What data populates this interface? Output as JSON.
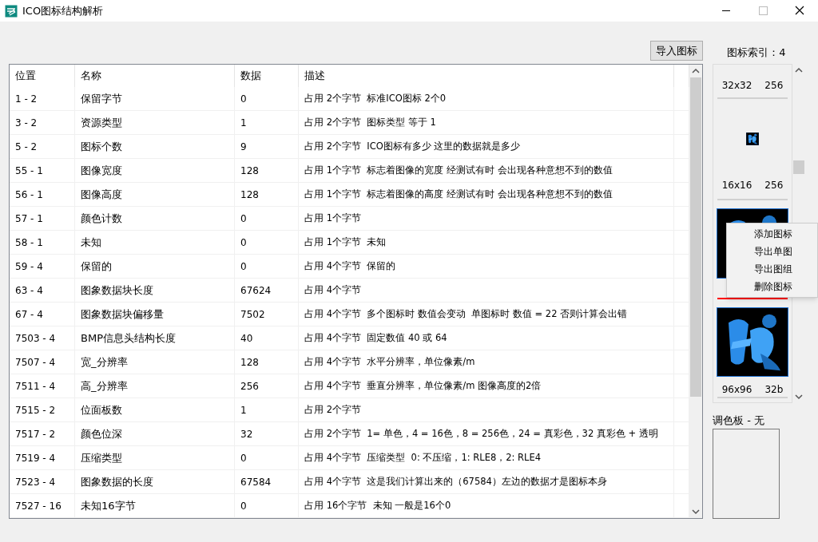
{
  "window": {
    "title": "ICO图标结构解析"
  },
  "import_button": "导入图标",
  "table": {
    "columns": [
      "位置",
      "名称",
      "数据",
      "描述"
    ],
    "rows": [
      {
        "position": "1 - 2",
        "name": "保留字节",
        "data": "0",
        "description": "占用 2个字节  标准ICO图标 2个0"
      },
      {
        "position": "3 - 2",
        "name": "资源类型",
        "data": "1",
        "description": "占用 2个字节  图标类型 等于 1"
      },
      {
        "position": "5 - 2",
        "name": "图标个数",
        "data": "9",
        "description": "占用 2个字节  ICO图标有多少 这里的数据就是多少"
      },
      {
        "position": "55 - 1",
        "name": "图像宽度",
        "data": "128",
        "description": "占用 1个字节  标志着图像的宽度 经测试有时 会出现各种意想不到的数值"
      },
      {
        "position": "56 - 1",
        "name": "图像高度",
        "data": "128",
        "description": "占用 1个字节  标志着图像的高度 经测试有时 会出现各种意想不到的数值"
      },
      {
        "position": "57 - 1",
        "name": "颜色计数",
        "data": "0",
        "description": "占用 1个字节"
      },
      {
        "position": "58 - 1",
        "name": "未知",
        "data": "0",
        "description": "占用 1个字节  未知"
      },
      {
        "position": "59 - 4",
        "name": "保留的",
        "data": "0",
        "description": "占用 4个字节  保留的"
      },
      {
        "position": "63 - 4",
        "name": "图象数据块长度",
        "data": "67624",
        "description": "占用 4个字节"
      },
      {
        "position": "67 - 4",
        "name": "图象数据块偏移量",
        "data": "7502",
        "description": "占用 4个字节  多个图标时 数值会变动  单图标时 数值 = 22 否则计算会出错"
      },
      {
        "position": "7503 - 4",
        "name": "BMP信息头结构长度",
        "data": "40",
        "description": "占用 4个字节  固定数值 40 或 64"
      },
      {
        "position": "7507 - 4",
        "name": "宽_分辨率",
        "data": "128",
        "description": "占用 4个字节  水平分辨率，单位像素/m"
      },
      {
        "position": "7511 - 4",
        "name": "高_分辨率",
        "data": "256",
        "description": "占用 4个字节  垂直分辨率，单位像素/m 图像高度的2倍"
      },
      {
        "position": "7515 - 2",
        "name": "位面板数",
        "data": "1",
        "description": "占用 2个字节"
      },
      {
        "position": "7517 - 2",
        "name": "颜色位深",
        "data": "32",
        "description": "占用 2个字节  1= 单色，4 = 16色，8 = 256色，24 = 真彩色，32 真彩色 + 透明"
      },
      {
        "position": "7519 - 4",
        "name": "压缩类型",
        "data": "0",
        "description": "占用 4个字节  压缩类型  0: 不压缩，1: RLE8，2: RLE4"
      },
      {
        "position": "7523 - 4",
        "name": "图象数据的长度",
        "data": "67584",
        "description": "占用 4个字节  这是我们计算出来的（67584）左边的数据才是图标本身"
      },
      {
        "position": "7527 - 16",
        "name": "未知16字节",
        "data": "0",
        "description": "占用 16个字节  未知 一般是16个0"
      }
    ]
  },
  "icon_index": "图标索引：4",
  "icon_list": [
    {
      "kind": "label",
      "size": "32x32",
      "depth": "256",
      "marked": false
    },
    {
      "kind": "small",
      "size": "16x16",
      "depth": "256",
      "marked": false
    },
    {
      "kind": "large",
      "marked": true
    },
    {
      "kind": "large",
      "size": "96x96",
      "depth": "32b",
      "marked": false
    }
  ],
  "context_menu": [
    "添加图标",
    "导出单图",
    "导出图组",
    "删除图标"
  ],
  "palette": {
    "label": "调色板 - 无"
  }
}
